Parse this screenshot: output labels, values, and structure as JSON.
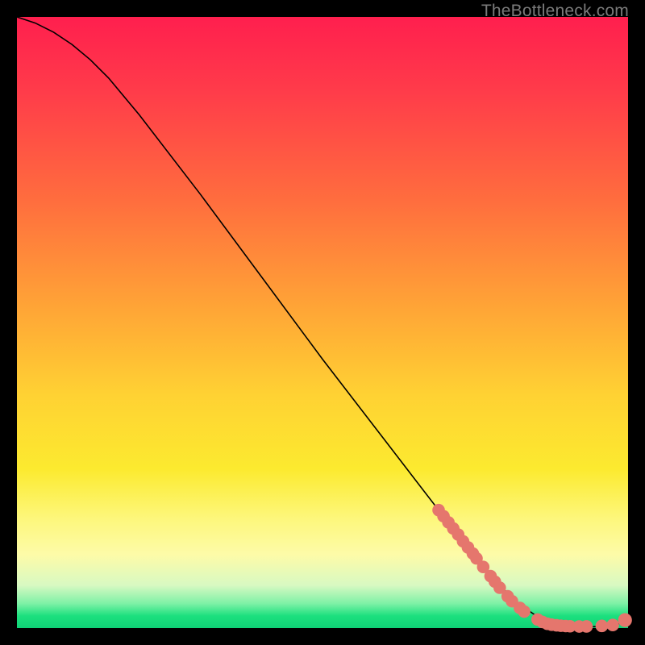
{
  "attribution": "TheBottleneck.com",
  "colors": {
    "page_bg": "#000000",
    "text": "#7a7a7a",
    "curve": "#000000",
    "marker": "#e5766d"
  },
  "chart_data": {
    "type": "line",
    "title": "",
    "xlabel": "",
    "ylabel": "",
    "xlim": [
      0,
      100
    ],
    "ylim": [
      0,
      100
    ],
    "curve": {
      "x": [
        0,
        3,
        6,
        9,
        12,
        15,
        20,
        30,
        40,
        50,
        60,
        70,
        78,
        82,
        85,
        88,
        90,
        92,
        94,
        96,
        98,
        100
      ],
      "y": [
        100,
        99,
        97.5,
        95.5,
        93,
        90,
        84,
        71,
        57.5,
        44,
        31,
        18,
        8,
        4,
        2,
        0.8,
        0.4,
        0.2,
        0.2,
        0.3,
        0.5,
        1.4
      ]
    },
    "markers": [
      {
        "x": 69.0,
        "y": 19.3,
        "r": 1.1
      },
      {
        "x": 69.8,
        "y": 18.3,
        "r": 1.1
      },
      {
        "x": 70.6,
        "y": 17.3,
        "r": 1.1
      },
      {
        "x": 71.4,
        "y": 16.3,
        "r": 1.1
      },
      {
        "x": 72.2,
        "y": 15.3,
        "r": 1.1
      },
      {
        "x": 73.0,
        "y": 14.2,
        "r": 1.1
      },
      {
        "x": 73.8,
        "y": 13.2,
        "r": 1.1
      },
      {
        "x": 74.6,
        "y": 12.2,
        "r": 1.1
      },
      {
        "x": 75.2,
        "y": 11.4,
        "r": 1.1
      },
      {
        "x": 76.3,
        "y": 10.0,
        "r": 1.1
      },
      {
        "x": 77.5,
        "y": 8.5,
        "r": 1.1
      },
      {
        "x": 78.2,
        "y": 7.6,
        "r": 1.1
      },
      {
        "x": 79.0,
        "y": 6.6,
        "r": 1.1
      },
      {
        "x": 80.3,
        "y": 5.2,
        "r": 1.1
      },
      {
        "x": 81.0,
        "y": 4.4,
        "r": 1.1
      },
      {
        "x": 82.3,
        "y": 3.3,
        "r": 1.1
      },
      {
        "x": 83.0,
        "y": 2.7,
        "r": 1.1
      },
      {
        "x": 85.2,
        "y": 1.4,
        "r": 1.1
      },
      {
        "x": 86.0,
        "y": 1.0,
        "r": 1.1
      },
      {
        "x": 86.8,
        "y": 0.7,
        "r": 1.1
      },
      {
        "x": 87.5,
        "y": 0.55,
        "r": 1.1
      },
      {
        "x": 88.3,
        "y": 0.45,
        "r": 1.1
      },
      {
        "x": 89.0,
        "y": 0.38,
        "r": 1.1
      },
      {
        "x": 89.8,
        "y": 0.33,
        "r": 1.1
      },
      {
        "x": 90.5,
        "y": 0.3,
        "r": 1.1
      },
      {
        "x": 92.0,
        "y": 0.26,
        "r": 1.1
      },
      {
        "x": 93.2,
        "y": 0.27,
        "r": 1.1
      },
      {
        "x": 95.7,
        "y": 0.35,
        "r": 1.1
      },
      {
        "x": 97.5,
        "y": 0.5,
        "r": 1.1
      },
      {
        "x": 99.5,
        "y": 1.3,
        "r": 1.3
      }
    ]
  }
}
